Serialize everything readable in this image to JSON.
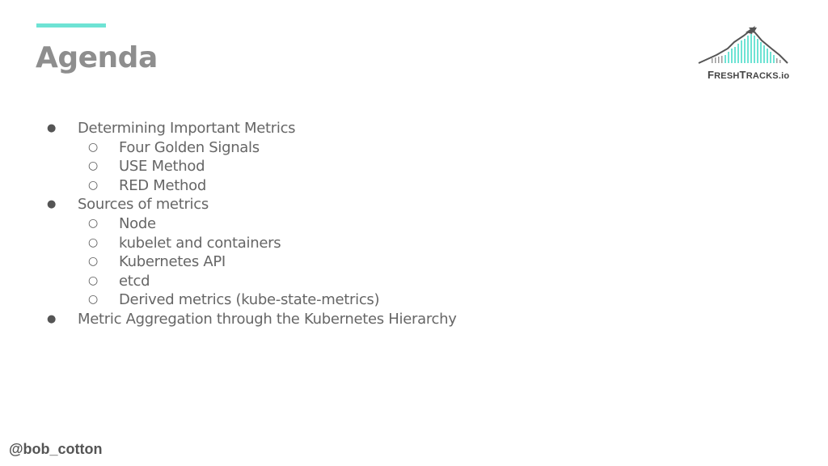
{
  "slide": {
    "title": "Agenda",
    "accent_color": "#6ee3d4",
    "logo": {
      "name": "mountain-logo",
      "text_prefix": "F",
      "text_mid1": "RESH",
      "text_mid2": "T",
      "text_mid3": "RACKS",
      "text_suffix": ".io"
    },
    "items": [
      {
        "level": 1,
        "bullet": "●",
        "text": "Determining Important Metrics"
      },
      {
        "level": 2,
        "bullet": "○",
        "text": "Four Golden Signals"
      },
      {
        "level": 2,
        "bullet": "○",
        "text": "USE Method"
      },
      {
        "level": 2,
        "bullet": "○",
        "text": "RED Method"
      },
      {
        "level": 1,
        "bullet": "●",
        "text": "Sources of metrics"
      },
      {
        "level": 2,
        "bullet": "○",
        "text": "Node"
      },
      {
        "level": 2,
        "bullet": "○",
        "text": "kubelet and containers"
      },
      {
        "level": 2,
        "bullet": "○",
        "text": "Kubernetes API"
      },
      {
        "level": 2,
        "bullet": "○",
        "text": "etcd"
      },
      {
        "level": 2,
        "bullet": "○",
        "text": "Derived metrics (kube-state-metrics)"
      },
      {
        "level": 1,
        "bullet": "●",
        "text": "Metric Aggregation through the Kubernetes Hierarchy"
      }
    ],
    "footer_handle": "@bob_cotton"
  }
}
